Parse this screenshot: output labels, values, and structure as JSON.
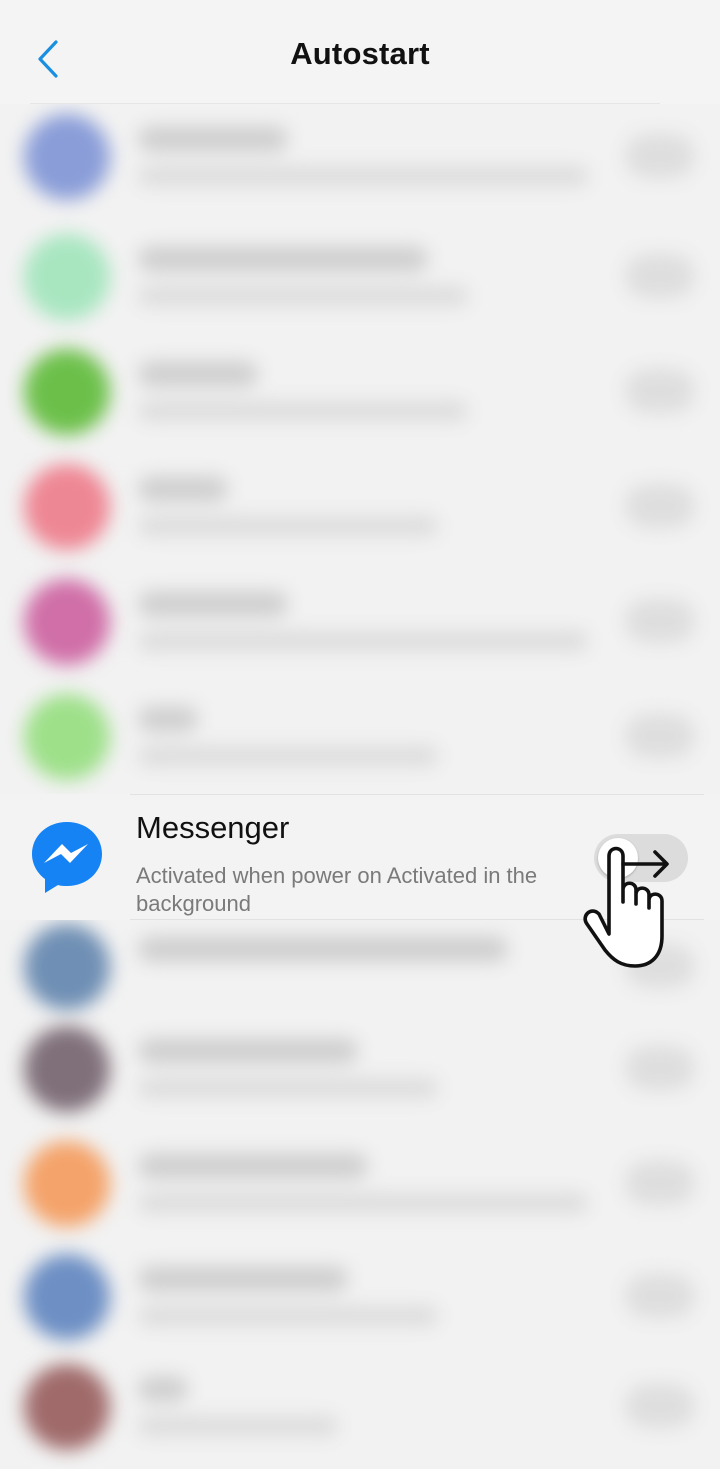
{
  "header": {
    "title": "Autostart",
    "accent_color": "#1a8fe0",
    "back_icon": "chevron-left-icon"
  },
  "blurred_rows": [
    {
      "icon_color": "#8a9dd8",
      "name_bar": 150,
      "desc_bar": 450
    },
    {
      "icon_color": "#a8e6c0",
      "name_bar": 290,
      "desc_bar": 330
    },
    {
      "icon_color": "#6cc04a",
      "name_bar": 120,
      "desc_bar": 330
    },
    {
      "icon_color": "#ee8794",
      "name_bar": 90,
      "desc_bar": 300
    },
    {
      "icon_color": "#d06fa8",
      "name_bar": 150,
      "desc_bar": 450
    },
    {
      "icon_color": "#9ee08a",
      "name_bar": 60,
      "desc_bar": 300
    },
    {
      "icon_color": "#6f8fb4",
      "name_bar": 370,
      "desc_bar": 0
    },
    {
      "icon_color": "#80707a",
      "name_bar": 220,
      "desc_bar": 300
    },
    {
      "icon_color": "#f4a36a",
      "name_bar": 230,
      "desc_bar": 450
    },
    {
      "icon_color": "#6d8fc4",
      "name_bar": 210,
      "desc_bar": 300
    },
    {
      "icon_color": "#a06a6a",
      "name_bar": 50,
      "desc_bar": 200
    }
  ],
  "messenger": {
    "name": "Messenger",
    "description": "Activated when power on  Activated in the background",
    "icon": "messenger-icon",
    "icon_color": "#1683f5",
    "toggle_on": false
  },
  "gesture": {
    "icon": "swipe-hand-icon"
  }
}
